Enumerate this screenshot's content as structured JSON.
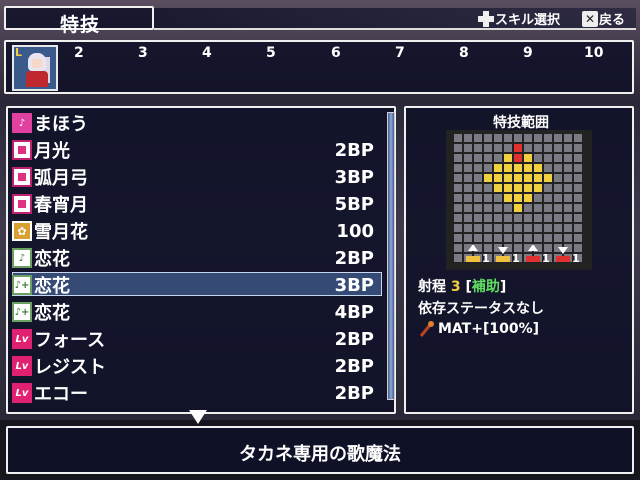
{
  "header": {
    "title": "特技",
    "hint_skill_select": "スキル選択",
    "hint_back": "戻る"
  },
  "party": {
    "level_badge": "L",
    "slot_numbers": [
      "2",
      "3",
      "4",
      "5",
      "6",
      "7",
      "8",
      "9",
      "10"
    ]
  },
  "skills": [
    {
      "icon": "magic-category-icon",
      "name": "まほう",
      "bp": ""
    },
    {
      "icon": "skill-box-icon",
      "name": "月光",
      "bp": "2BP"
    },
    {
      "icon": "skill-box-icon",
      "name": "弧月弓",
      "bp": "3BP"
    },
    {
      "icon": "skill-box-icon",
      "name": "春宵月",
      "bp": "5BP"
    },
    {
      "icon": "gold-flower-icon",
      "name": "雪月花",
      "bp": "100"
    },
    {
      "icon": "music-note-icon",
      "name": "恋花",
      "bp": "2BP"
    },
    {
      "icon": "music-plus-icon",
      "name": "恋花",
      "bp": "3BP"
    },
    {
      "icon": "music-plus-icon",
      "name": "恋花",
      "bp": "4BP"
    },
    {
      "icon": "level-icon",
      "name": "フォース",
      "bp": "2BP"
    },
    {
      "icon": "level-icon",
      "name": "レジスト",
      "bp": "2BP"
    },
    {
      "icon": "level-icon",
      "name": "エコー",
      "bp": "2BP"
    }
  ],
  "level_icon_text": "Lv",
  "selected_index": 6,
  "range_panel": {
    "title": "特技範囲",
    "modifiers": [
      "1",
      "1",
      "1",
      "1"
    ],
    "range_label": "射程",
    "range_value": "3",
    "range_type": "補助",
    "dependency": "依存ステータスなし",
    "bonus": "MAT+[100%]"
  },
  "description": "タカネ専用の歌魔法",
  "colors": {
    "window_bg": "#0e1028",
    "border": "#f0f0f0",
    "highlight_yellow": "#f0d040",
    "highlight_green": "#60e060",
    "range_red": "#e03030",
    "range_yellow": "#f0d040"
  }
}
